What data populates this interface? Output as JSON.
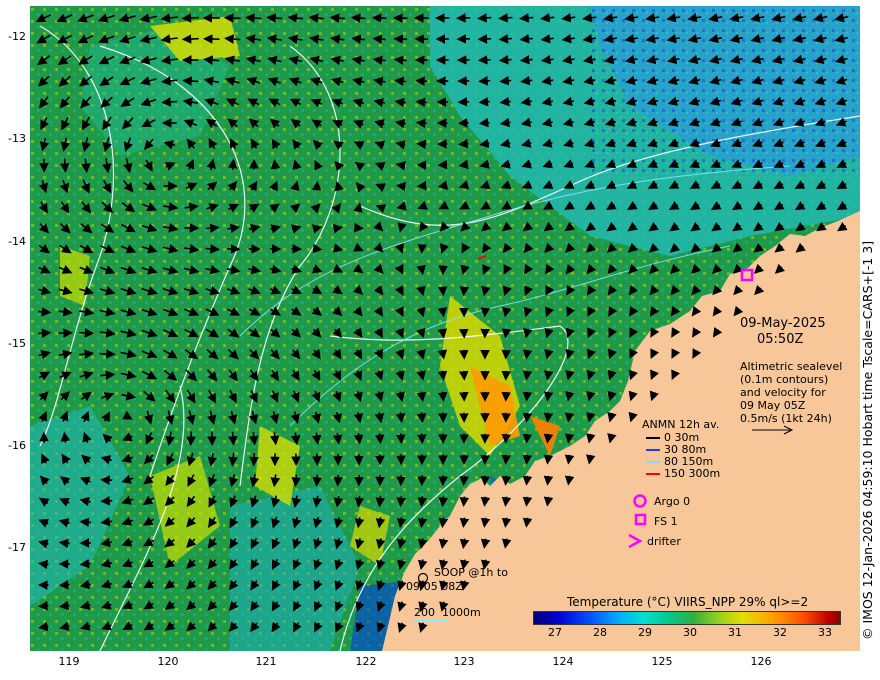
{
  "map": {
    "lat_ticks": [
      "-12",
      "-13",
      "-14",
      "-15",
      "-16",
      "-17"
    ],
    "lon_ticks": [
      "119",
      "120",
      "121",
      "122",
      "123",
      "124",
      "125",
      "126"
    ],
    "extent": {
      "lon_min": 118.6,
      "lon_max": 126.9,
      "lat_min": -17.9,
      "lat_max": -11.8
    },
    "land_color": "#f7c79a",
    "sea_colors": [
      "#1a8a3a",
      "#2aa040",
      "#19b08a",
      "#22c0c8",
      "#3a9ad8",
      "#9ad020",
      "#e0e000"
    ]
  },
  "date_label": {
    "date": "09-May-2025",
    "time": "05:50Z"
  },
  "altimetry_note": [
    "Altimetric sealevel",
    "(0.1m contours)",
    "and velocity for",
    "09 May 05Z",
    "0.5m/s (1kt 24h)"
  ],
  "anmn_legend": {
    "title": "ANMN 12h av.",
    "items": [
      {
        "label": "0 30m",
        "color": "#000000"
      },
      {
        "label": "30 80m",
        "color": "#1d3bff"
      },
      {
        "label": "80 150m",
        "color": "#8ad8ff"
      },
      {
        "label": "150 300m",
        "color": "#ff0000"
      }
    ]
  },
  "platforms": [
    {
      "label": "Argo 0",
      "symbol": "circle",
      "color": "#ff00ff"
    },
    {
      "label": "FS 1",
      "symbol": "square",
      "color": "#ff00ff"
    },
    {
      "label": "drifter",
      "symbol": "chevron",
      "color": "#ff00ff"
    }
  ],
  "soop": {
    "line1": "SOOP @1h to",
    "line2": "09/05 08Z"
  },
  "bathymetry": {
    "label1": "200",
    "label2": "1000m"
  },
  "colorbar": {
    "title": "Temperature (°C) VIIRS_NPP 29% ql>=2",
    "ticks": [
      "27",
      "28",
      "29",
      "30",
      "31",
      "32",
      "33"
    ]
  },
  "credit": "© IMOS 12-Jan-2026 04:59:10 Hobart time Tscale=CARS+[-1 3]"
}
